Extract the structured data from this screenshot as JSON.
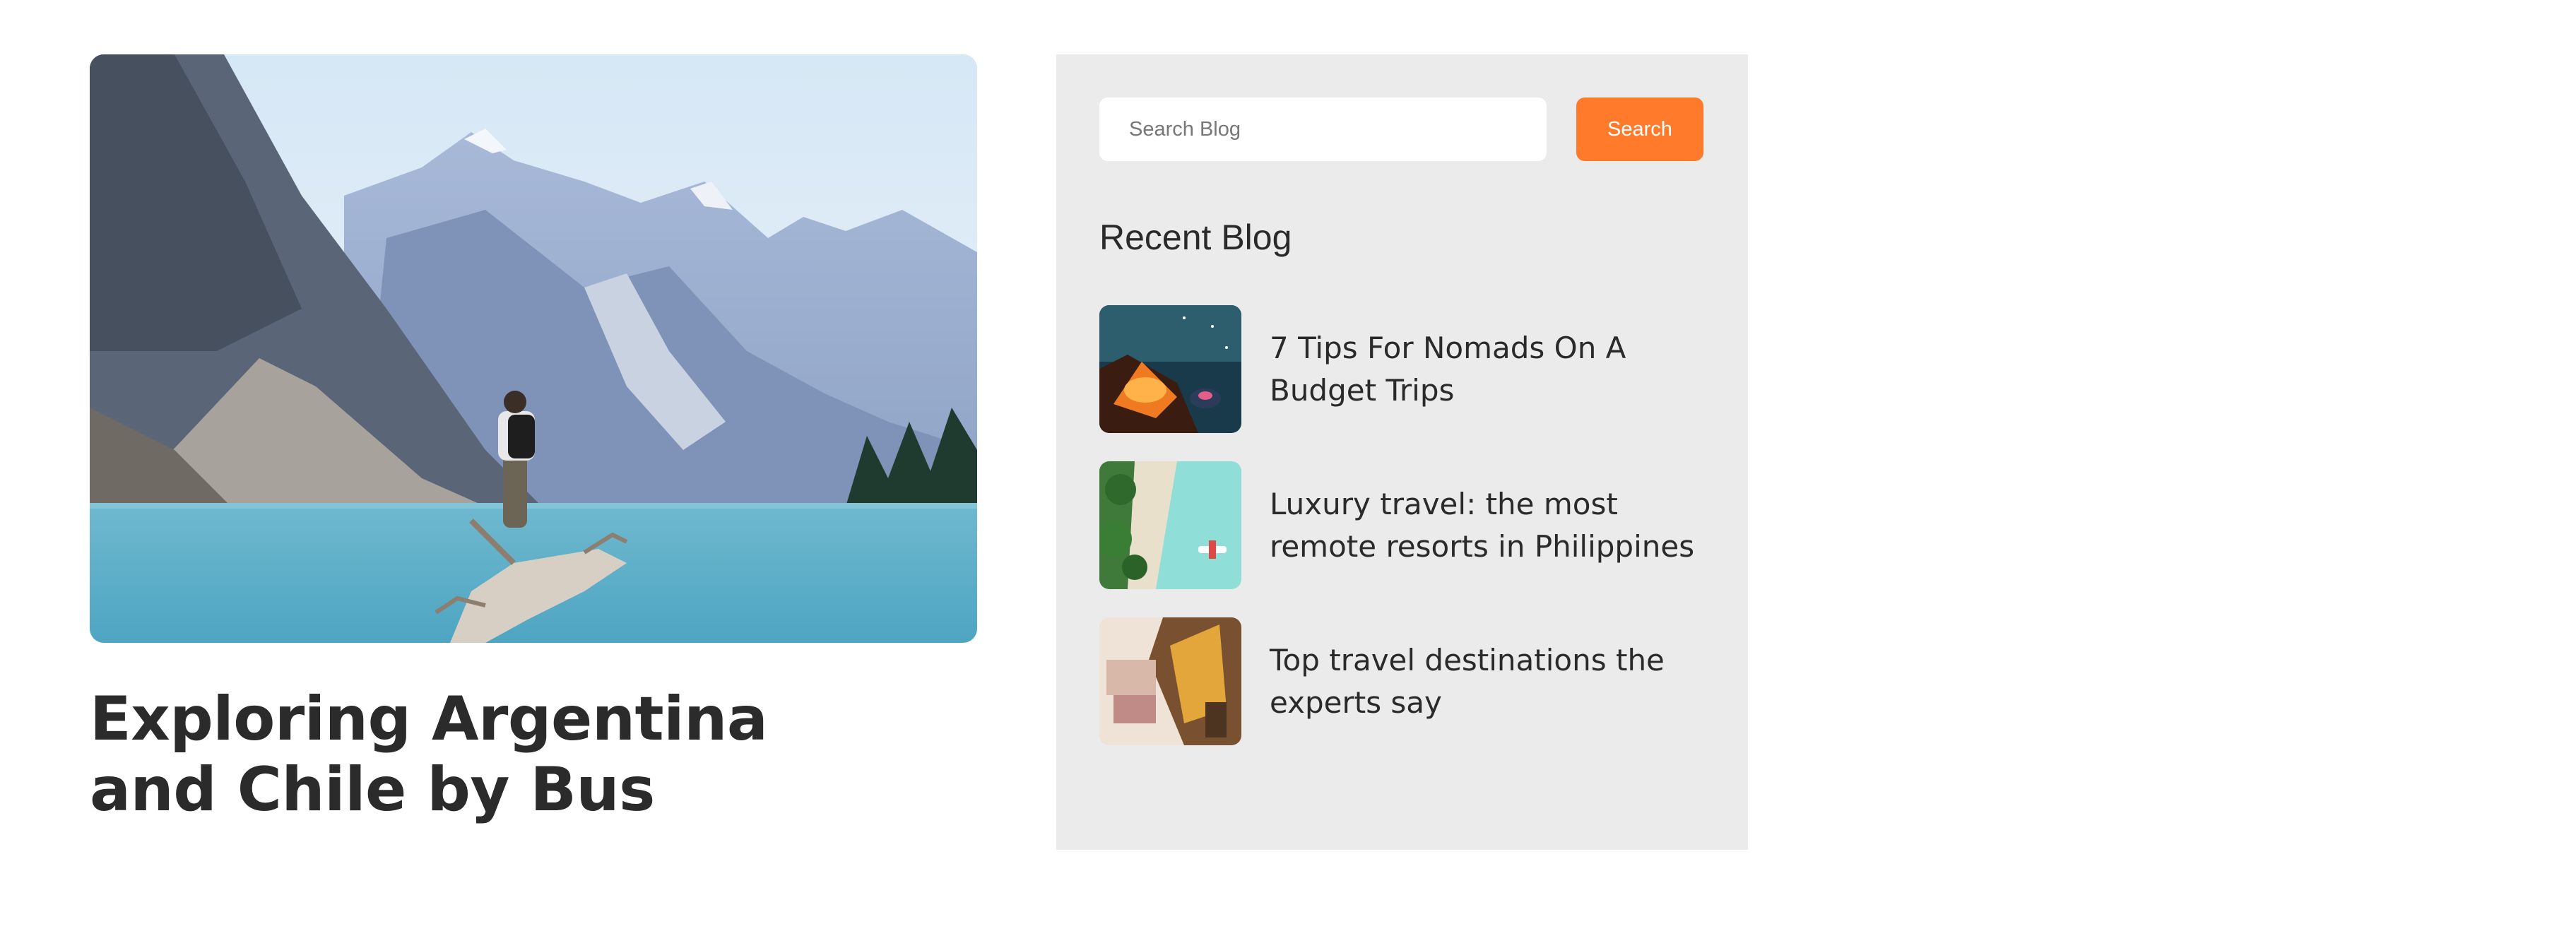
{
  "post": {
    "title": "Exploring Argentina and Chile by Bus"
  },
  "sidebar": {
    "search": {
      "placeholder": "Search Blog",
      "button_label": "Search"
    },
    "recent_title": "Recent Blog",
    "recent_posts": [
      {
        "title": "7 Tips For Nomads On A Budget Trips"
      },
      {
        "title": "Luxury travel: the most remote resorts in Philippines"
      },
      {
        "title": "Top travel destinations the experts say"
      }
    ]
  },
  "colors": {
    "accent": "#ff7a2b",
    "sidebar_bg": "#ebebeb",
    "text": "#2a2a2a"
  }
}
